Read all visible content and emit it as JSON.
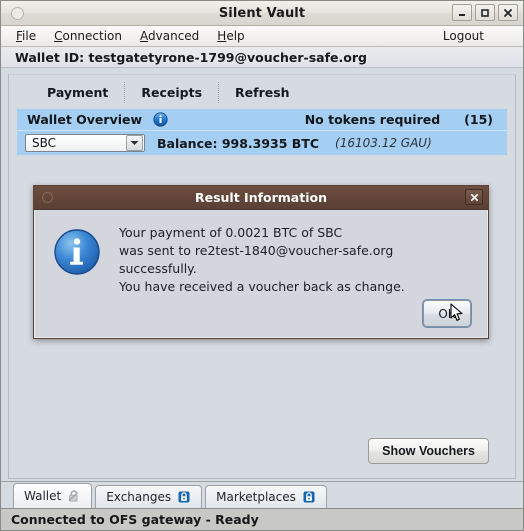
{
  "window": {
    "title": "Silent Vault",
    "controls": {
      "minimize": "minimize-button",
      "maximize": "maximize-button",
      "close": "close-button"
    }
  },
  "menubar": {
    "items": [
      {
        "label": "File",
        "mnemonic": "F"
      },
      {
        "label": "Connection",
        "mnemonic": "C"
      },
      {
        "label": "Advanced",
        "mnemonic": "A"
      },
      {
        "label": "Help",
        "mnemonic": "H"
      }
    ],
    "logout": "Logout"
  },
  "wallet_id_bar": {
    "text": "Wallet ID: testgatetyrone-1799@voucher-safe.org"
  },
  "actions": [
    {
      "label": "Payment"
    },
    {
      "label": "Receipts"
    },
    {
      "label": "Refresh"
    }
  ],
  "overview": {
    "title": "Wallet Overview",
    "info_icon": "info-icon",
    "tokens_status": "No tokens required",
    "token_count": "(15)",
    "currency_selected": "SBC",
    "currency_options": [
      "SBC"
    ],
    "balance": "Balance: 998.3935 BTC",
    "balance_alt": "(16103.12 GAU)",
    "highlight_color": "#a4cff2"
  },
  "buttons": {
    "show_vouchers": "Show Vouchers"
  },
  "tabs": [
    {
      "label": "Wallet",
      "icon": "unlocked-icon",
      "active": true
    },
    {
      "label": "Exchanges",
      "icon": "lock-icon",
      "active": false
    },
    {
      "label": "Marketplaces",
      "icon": "lock-icon",
      "active": false
    }
  ],
  "statusbar": {
    "text": "Connected to OFS gateway - Ready"
  },
  "dialog": {
    "title": "Result Information",
    "icon": "info-icon",
    "close_label": "close-icon",
    "message_lines": [
      "Your payment of 0.0021 BTC of SBC",
      "was sent to re2test-1840@voucher-safe.org successfully.",
      "You have received a voucher back as change."
    ],
    "ok_label": "OK",
    "titlebar_color": "#63453a"
  }
}
